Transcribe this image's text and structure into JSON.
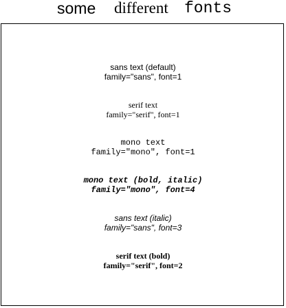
{
  "title": {
    "sans": "some",
    "serif": "different",
    "mono": "fonts"
  },
  "samples": [
    {
      "line1": "sans text (default)",
      "line2": "family=\"sans\", font=1"
    },
    {
      "line1": "serif text",
      "line2": "family=\"serif\", font=1"
    },
    {
      "line1": "mono text",
      "line2": "family=\"mono\", font=1"
    },
    {
      "line1": "mono text (bold, italic)",
      "line2": "family=\"mono\", font=4"
    },
    {
      "line1": "sans text (italic)",
      "line2": "family=\"sans\", font=3"
    },
    {
      "line1": "serif text (bold)",
      "line2": "family=\"serif\", font=2"
    }
  ]
}
